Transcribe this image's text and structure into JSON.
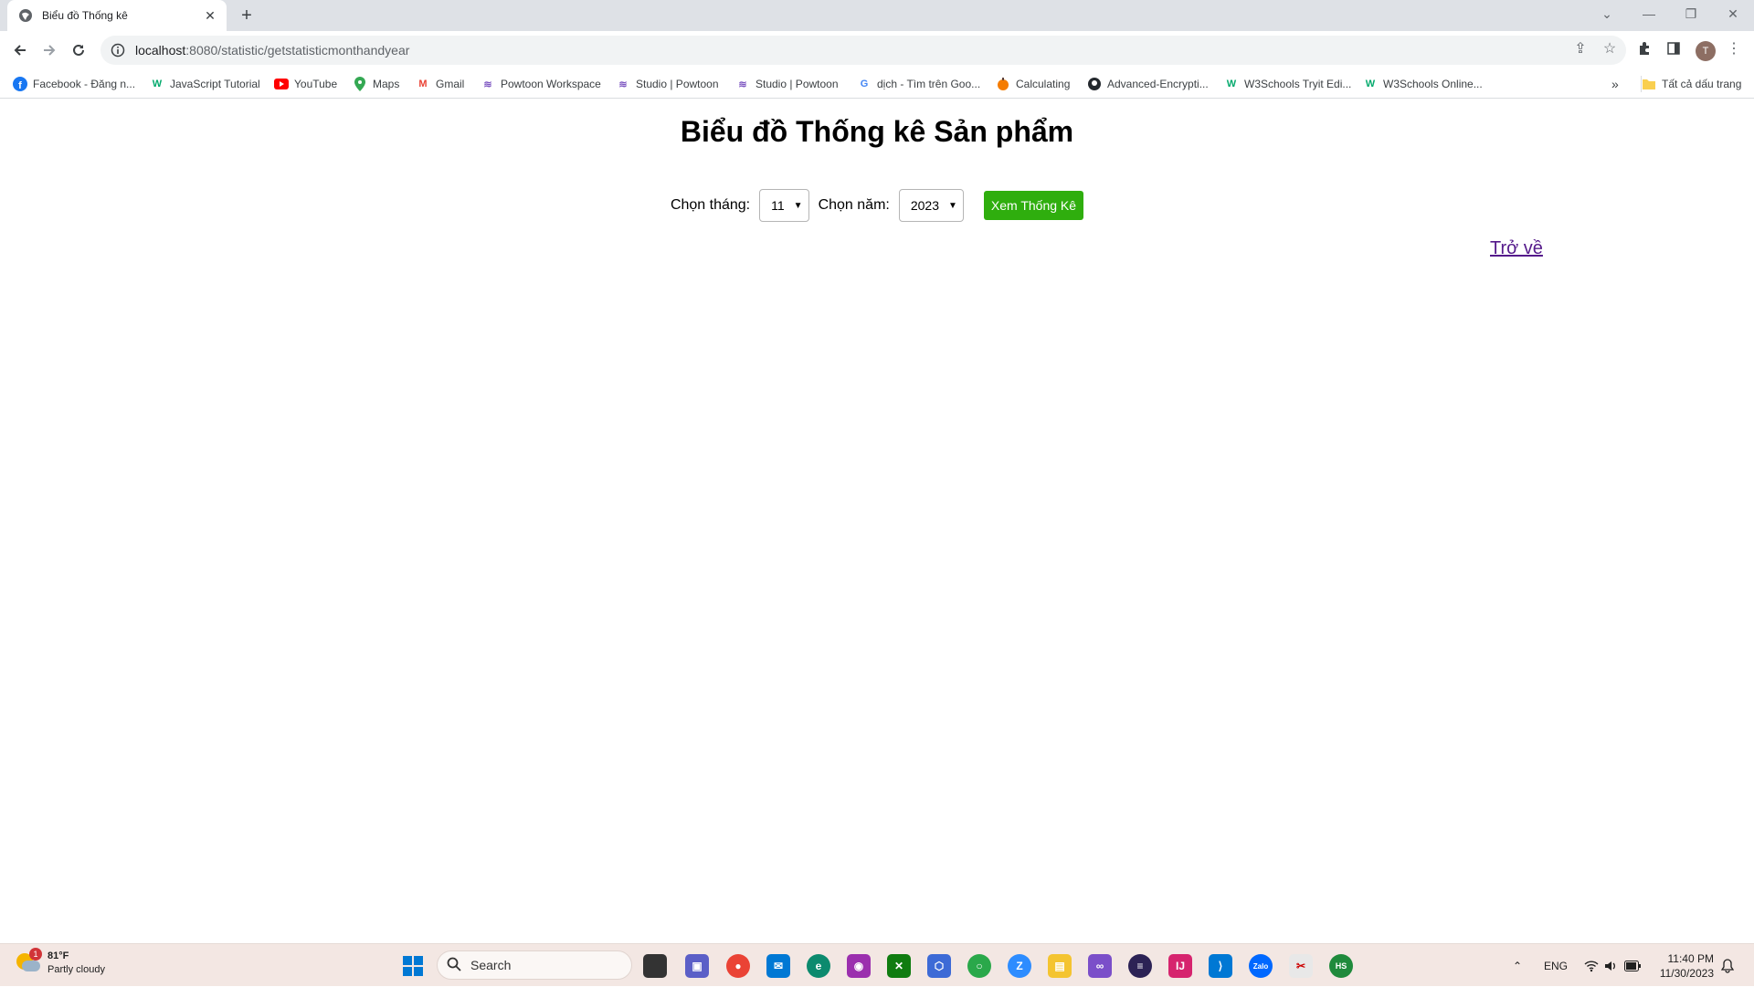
{
  "browser": {
    "tab_title": "Biểu đồ Thống kê",
    "url_host": "localhost",
    "url_rest": ":8080/statistic/getstatisticmonthandyear",
    "profile_initial": "T",
    "bookmarks": [
      {
        "label": "Facebook - Đăng n...",
        "icon": "facebook-icon",
        "color": "#1877f2"
      },
      {
        "label": "JavaScript Tutorial",
        "icon": "w3schools-icon",
        "color": "#04aa6d"
      },
      {
        "label": "YouTube",
        "icon": "youtube-icon",
        "color": "#ff0000"
      },
      {
        "label": "Maps",
        "icon": "maps-icon",
        "color": "#34a853"
      },
      {
        "label": "Gmail",
        "icon": "gmail-icon",
        "color": "#ea4335"
      },
      {
        "label": "Powtoon Workspace",
        "icon": "powtoon-icon",
        "color": "#7e57c2"
      },
      {
        "label": "Studio | Powtoon",
        "icon": "powtoon-icon",
        "color": "#7e57c2"
      },
      {
        "label": "Studio | Powtoon",
        "icon": "powtoon-icon",
        "color": "#7e57c2"
      },
      {
        "label": "dịch - Tìm trên Goo...",
        "icon": "google-icon",
        "color": "#4285f4"
      },
      {
        "label": "Calculating",
        "icon": "pumpkin-icon",
        "color": "#f57c00"
      },
      {
        "label": "Advanced-Encrypti...",
        "icon": "github-icon",
        "color": "#24292e"
      },
      {
        "label": "W3Schools Tryit Edi...",
        "icon": "w3schools-icon",
        "color": "#04aa6d"
      },
      {
        "label": "W3Schools Online...",
        "icon": "w3schools-icon",
        "color": "#04aa6d"
      }
    ],
    "overflow_label": "»",
    "all_bookmarks_label": "Tất cả dấu trang"
  },
  "page": {
    "title": "Biểu đồ Thống kê Sản phẩm",
    "month_label": "Chọn tháng:",
    "month_value": "11",
    "year_label": "Chọn năm:",
    "year_value": "2023",
    "submit_label": "Xem Thống Kê",
    "back_link": "Trở về",
    "accent_color": "#2fae0e"
  },
  "taskbar": {
    "temperature": "81°F",
    "weather": "Partly cloudy",
    "weather_badge": "1",
    "search_placeholder": "Search",
    "language": "ENG",
    "time": "11:40 PM",
    "date": "11/30/2023"
  }
}
